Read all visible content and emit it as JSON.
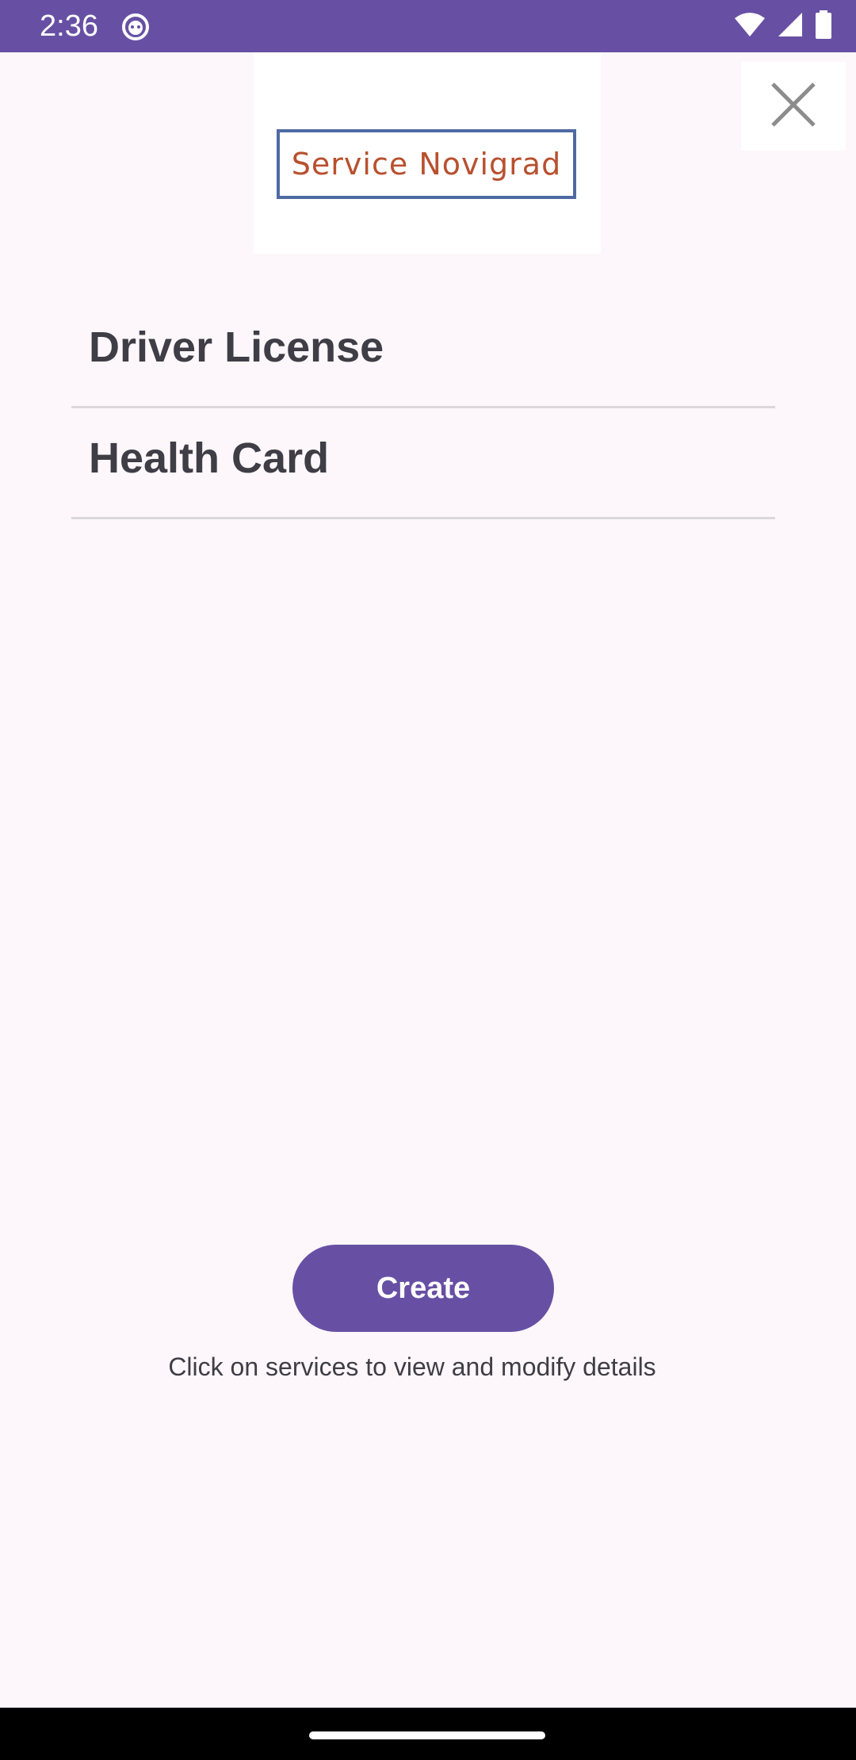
{
  "status_bar": {
    "time": "2:36",
    "background_color": "#6750a4",
    "icons": [
      "notification-cat-icon",
      "wifi-icon",
      "cellular-signal-icon",
      "battery-icon"
    ]
  },
  "header": {
    "logo_text": "Service Novigrad",
    "close_icon": "close-icon"
  },
  "services": {
    "items": [
      {
        "label": "Driver License"
      },
      {
        "label": "Health Card"
      }
    ]
  },
  "actions": {
    "create_label": "Create",
    "hint": "Click on services to view and modify details"
  },
  "colors": {
    "accent": "#6750a4",
    "background": "#fdf7fb",
    "text": "#3f3d45",
    "logo_text": "#b8502f",
    "logo_border": "#4f6aa3"
  }
}
